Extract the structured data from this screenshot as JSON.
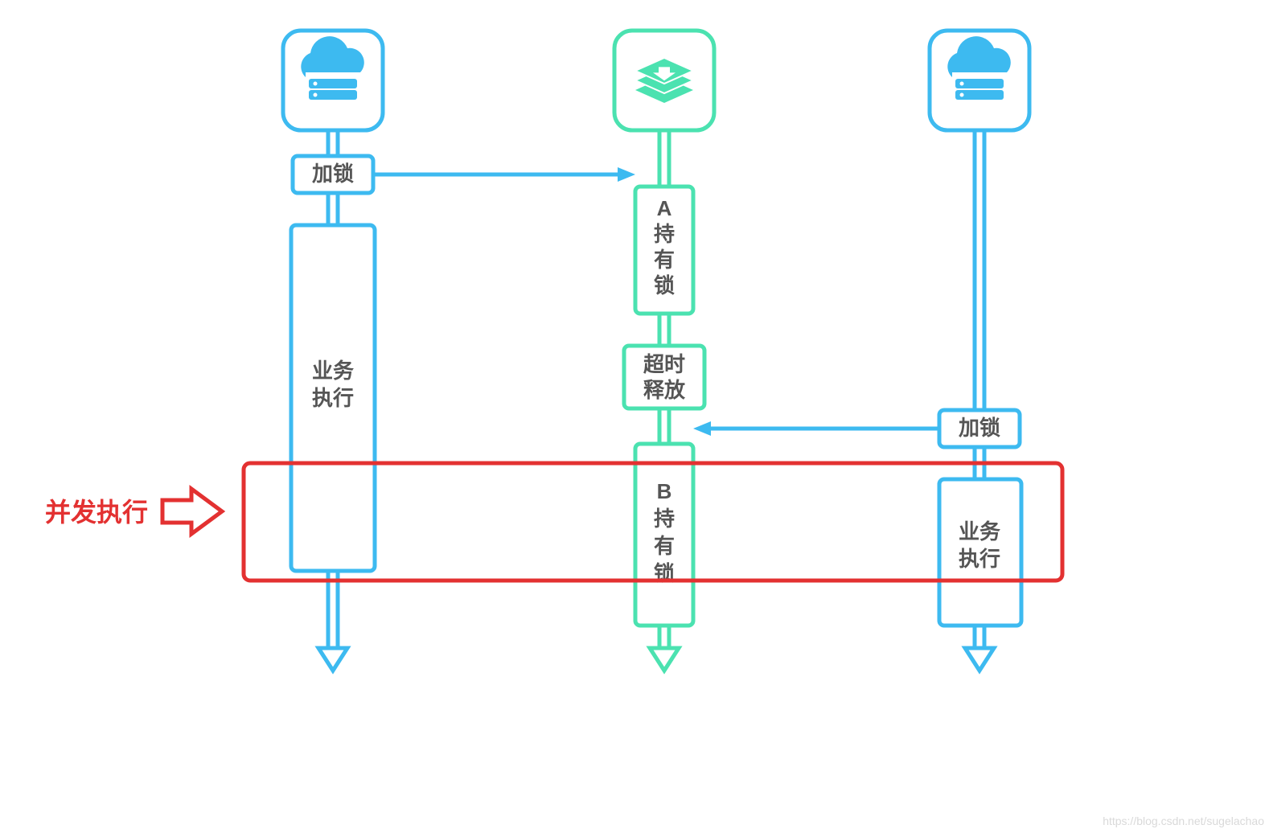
{
  "colors": {
    "blue": "#3dbaf0",
    "green": "#4be2b0",
    "red": "#e33131",
    "text": "#555555"
  },
  "lanes": {
    "clientA": {
      "icon": "cloud-server-icon",
      "lock_label": "加锁",
      "exec_label_l1": "业务",
      "exec_label_l2": "执行"
    },
    "server": {
      "icon": "layers-icon",
      "a_holds_l1": "A",
      "a_holds_l2": "持",
      "a_holds_l3": "有",
      "a_holds_l4": "锁",
      "timeout_l1": "超时",
      "timeout_l2": "释放",
      "b_holds_l1": "B",
      "b_holds_l2": "持",
      "b_holds_l3": "有",
      "b_holds_l4": "锁"
    },
    "clientB": {
      "icon": "cloud-server-icon",
      "lock_label": "加锁",
      "exec_label_l1": "业务",
      "exec_label_l2": "执行"
    }
  },
  "annotation": {
    "concurrent_label": "并发执行"
  },
  "watermark": "https://blog.csdn.net/sugelachao"
}
